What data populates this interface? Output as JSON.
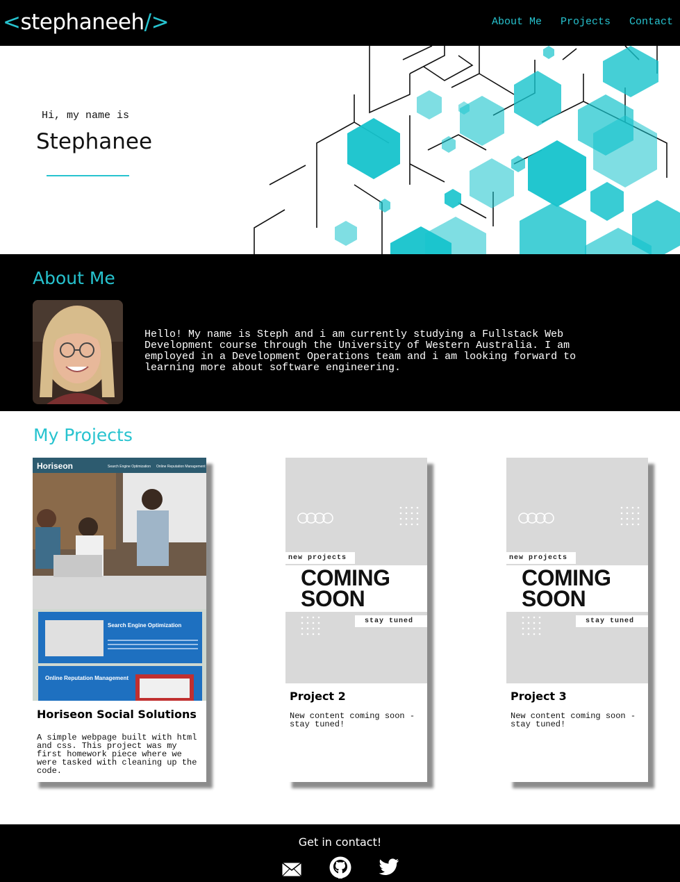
{
  "header": {
    "logo_open": "<",
    "logo_text": "stephaneeh",
    "logo_close": "/>",
    "nav": [
      "About Me",
      "Projects",
      "Contact"
    ]
  },
  "hero": {
    "greeting": "Hi, my name is",
    "name": "Stephanee"
  },
  "about": {
    "title": "About Me",
    "text": "Hello! My name is Steph and i am currently studying a Fullstack Web Development course through the University of Western Australia. I am employed in a Development Operations team and i am looking forward to learning more about software engineering."
  },
  "projects": {
    "title": "My Projects",
    "items": [
      {
        "title": "Horiseon Social Solutions",
        "description": "A simple webpage built with html and css. This project was my first homework piece where we were tasked with cleaning up the code.",
        "thumb": {
          "brand": "Horiseon",
          "nav1": "Search Engine Optimization",
          "nav2": "Online Reputation Management",
          "section1": "Search Engine Optimization",
          "section2": "Online Reputation Management"
        }
      },
      {
        "title": "Project 2",
        "description": "New content coming soon - stay tuned!",
        "thumb": {
          "tag1": "new projects",
          "line1": "COMING",
          "line2": "SOON",
          "tag2": "stay tuned"
        }
      },
      {
        "title": "Project 3",
        "description": "New content coming soon - stay tuned!",
        "thumb": {
          "tag1": "new projects",
          "line1": "COMING",
          "line2": "SOON",
          "tag2": "stay tuned"
        }
      }
    ]
  },
  "footer": {
    "title": "Get in contact!",
    "icons": [
      "mail-icon",
      "github-icon",
      "twitter-icon"
    ]
  },
  "colors": {
    "accent": "#27c3cf",
    "dark": "#000000"
  }
}
